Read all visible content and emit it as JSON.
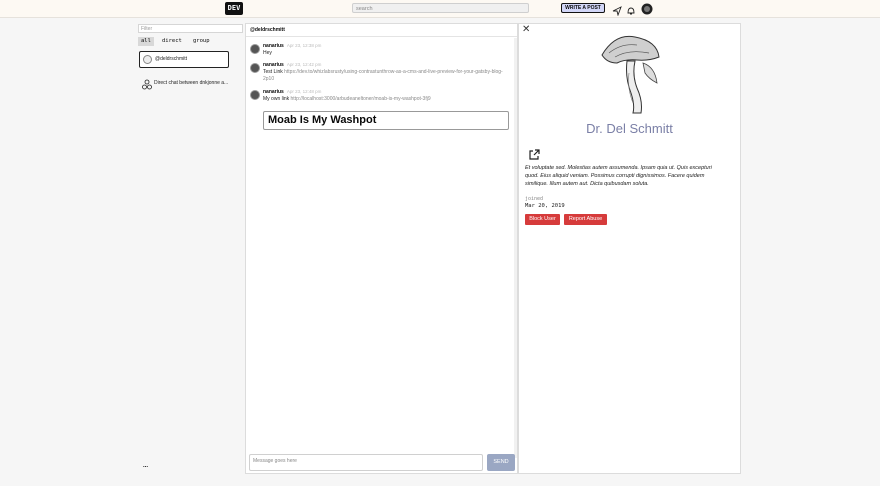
{
  "topbar": {
    "logo": "DEV",
    "search_placeholder": "search",
    "write_post_label": "WRITE A POST"
  },
  "sidebar": {
    "filter_placeholder": "Filter",
    "tabs": [
      {
        "label": "all",
        "active": true
      },
      {
        "label": "direct",
        "active": false
      },
      {
        "label": "group",
        "active": false
      }
    ],
    "channels": [
      {
        "label": "@deldrschmitt",
        "selected": true
      },
      {
        "label": "Direct chat between dnkjonne a...",
        "selected": false
      }
    ],
    "more": "..."
  },
  "chat": {
    "header": "@deldrschmitt",
    "messages": [
      {
        "name": "nanarius",
        "time": "Apr 23, 12:38 pm",
        "text": "Hey",
        "link": ""
      },
      {
        "name": "nanarius",
        "time": "Apr 23, 12:42 pm",
        "text": "Test Link",
        "link": "https://dev.to/whizlabsrusty/using-contrastunthrow-as-a-cms-and-live-preview-for-your-gatsby-blog-2p10"
      },
      {
        "name": "nanarius",
        "time": "Apr 23, 12:48 pm",
        "text": "My own link",
        "link": "http://localhost:3000/arbudeaneltoner/moab-is-my-washpot-3fj9"
      }
    ],
    "embed_title": "Moab Is My Washpot",
    "composer_placeholder": "Message goes here",
    "send_label": "SEND"
  },
  "profile": {
    "name": "Dr. Del Schmitt",
    "bio": "Et voluptate sed. Molestias autem assumenda. Ipsam quia ut. Quis excepturi quod. Eius aliquid veniam. Possimus corrupti dignissimos. Facere quidem similique. Illum autem aut. Dicta quibusdam soluta.",
    "joined_label": "joined",
    "joined_value": "Mar 20, 2019",
    "block_label": "Block User",
    "report_label": "Report Abuse"
  },
  "colors": {
    "accent": "#7a7fa6",
    "danger": "#d63b3b",
    "send": "#9aa7c3"
  }
}
